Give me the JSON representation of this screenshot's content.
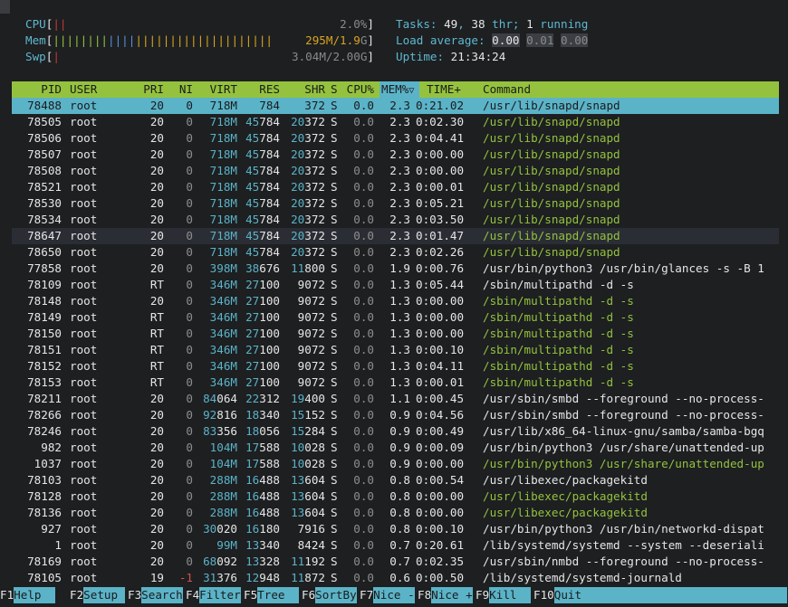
{
  "meters": {
    "cpu": {
      "label": "CPU",
      "bar": "||",
      "value": "2.0%"
    },
    "mem": {
      "label": "Mem",
      "bar_green": "||||||||",
      "bar_blue": "||||",
      "bar_orange": "||||||||||||||||||||",
      "value": "295M/1.9",
      "unit": "G"
    },
    "swp": {
      "label": "Swp",
      "bar": "|",
      "value": "3.04M/2.00G"
    }
  },
  "summary": {
    "tasks_label": "Tasks: ",
    "tasks": "49",
    "thr_sep": ", ",
    "threads": "38",
    "thr_label": " thr; ",
    "running": "1",
    "running_label": " running",
    "load_label": "Load average: ",
    "load1": "0.00",
    "load5": "0.01",
    "load15": "0.00",
    "uptime_label": "Uptime: ",
    "uptime": "21:34:24"
  },
  "headers": {
    "pid": "PID",
    "user": "USER",
    "pri": "PRI",
    "ni": "NI",
    "virt": "VIRT",
    "res": "RES",
    "shr": "SHR",
    "s": "S",
    "cpu": "CPU%",
    "mem": "MEM%",
    "time": "TIME+",
    "command": "Command",
    "sort_icon": "▽"
  },
  "accent": {
    "header_bg": "#94c23e",
    "selection_bg": "#5bb3c8",
    "thread_text": "#94c23e"
  },
  "processes": [
    {
      "pid": "78488",
      "user": "root",
      "pri": "20",
      "ni": "0",
      "virt": "718M",
      "res": "45784",
      "shr": "20372",
      "s": "S",
      "cpu": "0.0",
      "mem": "2.3",
      "time": "0:21.02",
      "command": "/usr/lib/snapd/snapd",
      "thread": false,
      "selected": true
    },
    {
      "pid": "78505",
      "user": "root",
      "pri": "20",
      "ni": "0",
      "virt": "718M",
      "res": "45784",
      "shr": "20372",
      "s": "S",
      "cpu": "0.0",
      "mem": "2.3",
      "time": "0:02.30",
      "command": "/usr/lib/snapd/snapd",
      "thread": true
    },
    {
      "pid": "78506",
      "user": "root",
      "pri": "20",
      "ni": "0",
      "virt": "718M",
      "res": "45784",
      "shr": "20372",
      "s": "S",
      "cpu": "0.0",
      "mem": "2.3",
      "time": "0:04.41",
      "command": "/usr/lib/snapd/snapd",
      "thread": true
    },
    {
      "pid": "78507",
      "user": "root",
      "pri": "20",
      "ni": "0",
      "virt": "718M",
      "res": "45784",
      "shr": "20372",
      "s": "S",
      "cpu": "0.0",
      "mem": "2.3",
      "time": "0:00.00",
      "command": "/usr/lib/snapd/snapd",
      "thread": true
    },
    {
      "pid": "78508",
      "user": "root",
      "pri": "20",
      "ni": "0",
      "virt": "718M",
      "res": "45784",
      "shr": "20372",
      "s": "S",
      "cpu": "0.0",
      "mem": "2.3",
      "time": "0:00.00",
      "command": "/usr/lib/snapd/snapd",
      "thread": true
    },
    {
      "pid": "78521",
      "user": "root",
      "pri": "20",
      "ni": "0",
      "virt": "718M",
      "res": "45784",
      "shr": "20372",
      "s": "S",
      "cpu": "0.0",
      "mem": "2.3",
      "time": "0:00.01",
      "command": "/usr/lib/snapd/snapd",
      "thread": true
    },
    {
      "pid": "78530",
      "user": "root",
      "pri": "20",
      "ni": "0",
      "virt": "718M",
      "res": "45784",
      "shr": "20372",
      "s": "S",
      "cpu": "0.0",
      "mem": "2.3",
      "time": "0:05.21",
      "command": "/usr/lib/snapd/snapd",
      "thread": true
    },
    {
      "pid": "78534",
      "user": "root",
      "pri": "20",
      "ni": "0",
      "virt": "718M",
      "res": "45784",
      "shr": "20372",
      "s": "S",
      "cpu": "0.0",
      "mem": "2.3",
      "time": "0:03.50",
      "command": "/usr/lib/snapd/snapd",
      "thread": true
    },
    {
      "pid": "78647",
      "user": "root",
      "pri": "20",
      "ni": "0",
      "virt": "718M",
      "res": "45784",
      "shr": "20372",
      "s": "S",
      "cpu": "0.0",
      "mem": "2.3",
      "time": "0:01.47",
      "command": "/usr/lib/snapd/snapd",
      "thread": true,
      "alt": true
    },
    {
      "pid": "78650",
      "user": "root",
      "pri": "20",
      "ni": "0",
      "virt": "718M",
      "res": "45784",
      "shr": "20372",
      "s": "S",
      "cpu": "0.0",
      "mem": "2.3",
      "time": "0:02.26",
      "command": "/usr/lib/snapd/snapd",
      "thread": true
    },
    {
      "pid": "77858",
      "user": "root",
      "pri": "20",
      "ni": "0",
      "virt": "398M",
      "res": "38676",
      "shr": "11800",
      "s": "S",
      "cpu": "0.0",
      "mem": "1.9",
      "time": "0:00.76",
      "command": "/usr/bin/python3 /usr/bin/glances -s -B 1",
      "thread": false
    },
    {
      "pid": "78109",
      "user": "root",
      "pri": "RT",
      "ni": "0",
      "virt": "346M",
      "res": "27100",
      "shr": "9072",
      "s": "S",
      "cpu": "0.0",
      "mem": "1.3",
      "time": "0:05.44",
      "command": "/sbin/multipathd -d -s",
      "thread": false
    },
    {
      "pid": "78148",
      "user": "root",
      "pri": "20",
      "ni": "0",
      "virt": "346M",
      "res": "27100",
      "shr": "9072",
      "s": "S",
      "cpu": "0.0",
      "mem": "1.3",
      "time": "0:00.00",
      "command": "/sbin/multipathd -d -s",
      "thread": true
    },
    {
      "pid": "78149",
      "user": "root",
      "pri": "RT",
      "ni": "0",
      "virt": "346M",
      "res": "27100",
      "shr": "9072",
      "s": "S",
      "cpu": "0.0",
      "mem": "1.3",
      "time": "0:00.00",
      "command": "/sbin/multipathd -d -s",
      "thread": true
    },
    {
      "pid": "78150",
      "user": "root",
      "pri": "RT",
      "ni": "0",
      "virt": "346M",
      "res": "27100",
      "shr": "9072",
      "s": "S",
      "cpu": "0.0",
      "mem": "1.3",
      "time": "0:00.00",
      "command": "/sbin/multipathd -d -s",
      "thread": true
    },
    {
      "pid": "78151",
      "user": "root",
      "pri": "RT",
      "ni": "0",
      "virt": "346M",
      "res": "27100",
      "shr": "9072",
      "s": "S",
      "cpu": "0.0",
      "mem": "1.3",
      "time": "0:00.10",
      "command": "/sbin/multipathd -d -s",
      "thread": true
    },
    {
      "pid": "78152",
      "user": "root",
      "pri": "RT",
      "ni": "0",
      "virt": "346M",
      "res": "27100",
      "shr": "9072",
      "s": "S",
      "cpu": "0.0",
      "mem": "1.3",
      "time": "0:04.11",
      "command": "/sbin/multipathd -d -s",
      "thread": true
    },
    {
      "pid": "78153",
      "user": "root",
      "pri": "RT",
      "ni": "0",
      "virt": "346M",
      "res": "27100",
      "shr": "9072",
      "s": "S",
      "cpu": "0.0",
      "mem": "1.3",
      "time": "0:00.01",
      "command": "/sbin/multipathd -d -s",
      "thread": true
    },
    {
      "pid": "78211",
      "user": "root",
      "pri": "20",
      "ni": "0",
      "virt": "84064",
      "res": "22312",
      "shr": "19400",
      "s": "S",
      "cpu": "0.0",
      "mem": "1.1",
      "time": "0:00.45",
      "command": "/usr/sbin/smbd --foreground --no-process-",
      "thread": false
    },
    {
      "pid": "78266",
      "user": "root",
      "pri": "20",
      "ni": "0",
      "virt": "92816",
      "res": "18340",
      "shr": "15152",
      "s": "S",
      "cpu": "0.0",
      "mem": "0.9",
      "time": "0:04.56",
      "command": "/usr/sbin/smbd --foreground --no-process-",
      "thread": false
    },
    {
      "pid": "78246",
      "user": "root",
      "pri": "20",
      "ni": "0",
      "virt": "83356",
      "res": "18056",
      "shr": "15284",
      "s": "S",
      "cpu": "0.0",
      "mem": "0.9",
      "time": "0:00.49",
      "command": "/usr/lib/x86_64-linux-gnu/samba/samba-bgq",
      "thread": false
    },
    {
      "pid": "982",
      "user": "root",
      "pri": "20",
      "ni": "0",
      "virt": "104M",
      "res": "17588",
      "shr": "10028",
      "s": "S",
      "cpu": "0.0",
      "mem": "0.9",
      "time": "0:00.09",
      "command": "/usr/bin/python3 /usr/share/unattended-up",
      "thread": false
    },
    {
      "pid": "1037",
      "user": "root",
      "pri": "20",
      "ni": "0",
      "virt": "104M",
      "res": "17588",
      "shr": "10028",
      "s": "S",
      "cpu": "0.0",
      "mem": "0.9",
      "time": "0:00.00",
      "command": "/usr/bin/python3 /usr/share/unattended-up",
      "thread": true
    },
    {
      "pid": "78103",
      "user": "root",
      "pri": "20",
      "ni": "0",
      "virt": "288M",
      "res": "16488",
      "shr": "13604",
      "s": "S",
      "cpu": "0.0",
      "mem": "0.8",
      "time": "0:00.54",
      "command": "/usr/libexec/packagekitd",
      "thread": false
    },
    {
      "pid": "78128",
      "user": "root",
      "pri": "20",
      "ni": "0",
      "virt": "288M",
      "res": "16488",
      "shr": "13604",
      "s": "S",
      "cpu": "0.0",
      "mem": "0.8",
      "time": "0:00.00",
      "command": "/usr/libexec/packagekitd",
      "thread": true
    },
    {
      "pid": "78136",
      "user": "root",
      "pri": "20",
      "ni": "0",
      "virt": "288M",
      "res": "16488",
      "shr": "13604",
      "s": "S",
      "cpu": "0.0",
      "mem": "0.8",
      "time": "0:00.00",
      "command": "/usr/libexec/packagekitd",
      "thread": true
    },
    {
      "pid": "927",
      "user": "root",
      "pri": "20",
      "ni": "0",
      "virt": "30020",
      "res": "16180",
      "shr": "7916",
      "s": "S",
      "cpu": "0.0",
      "mem": "0.8",
      "time": "0:00.10",
      "command": "/usr/bin/python3 /usr/bin/networkd-dispat",
      "thread": false
    },
    {
      "pid": "1",
      "user": "root",
      "pri": "20",
      "ni": "0",
      "virt": "99M",
      "res": "13340",
      "shr": "8424",
      "s": "S",
      "cpu": "0.0",
      "mem": "0.7",
      "time": "0:20.61",
      "command": "/lib/systemd/systemd --system --deseriali",
      "thread": false
    },
    {
      "pid": "78169",
      "user": "root",
      "pri": "20",
      "ni": "0",
      "virt": "68092",
      "res": "13328",
      "shr": "11192",
      "s": "S",
      "cpu": "0.0",
      "mem": "0.7",
      "time": "0:02.35",
      "command": "/usr/sbin/nmbd --foreground --no-process-",
      "thread": false
    },
    {
      "pid": "78105",
      "user": "root",
      "pri": "19",
      "ni": "-1",
      "virt": "31376",
      "res": "12948",
      "shr": "11872",
      "s": "S",
      "cpu": "0.0",
      "mem": "0.6",
      "time": "0:00.50",
      "command": "/lib/systemd/systemd-journald",
      "thread": false
    }
  ],
  "footer": [
    {
      "key": "F1",
      "label": "Help  "
    },
    {
      "key": "F2",
      "label": "Setup "
    },
    {
      "key": "F3",
      "label": "Search"
    },
    {
      "key": "F4",
      "label": "Filter"
    },
    {
      "key": "F5",
      "label": "Tree  "
    },
    {
      "key": "F6",
      "label": "SortBy"
    },
    {
      "key": "F7",
      "label": "Nice -"
    },
    {
      "key": "F8",
      "label": "Nice +"
    },
    {
      "key": "F9",
      "label": "Kill  "
    },
    {
      "key": "F10",
      "label": "Quit"
    }
  ]
}
